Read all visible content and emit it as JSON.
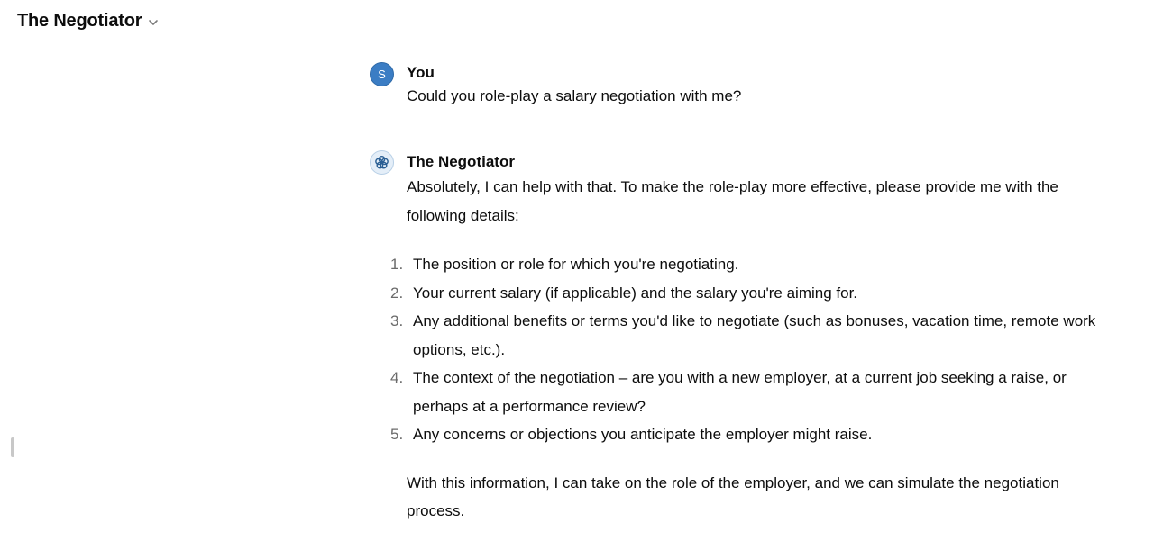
{
  "header": {
    "title": "The Negotiator",
    "chevron_icon": "chevron-down-icon"
  },
  "messages": {
    "user": {
      "avatar_letter": "S",
      "avatar_color": "#3b7dc4",
      "author": "You",
      "text": "Could you role-play a salary negotiation with me?"
    },
    "assistant": {
      "avatar_icon": "flower-logo-icon",
      "author": "The Negotiator",
      "intro": "Absolutely, I can help with that. To make the role-play more effective, please provide me with the following details:",
      "list": [
        {
          "num": "1.",
          "text": "The position or role for which you're negotiating."
        },
        {
          "num": "2.",
          "text": "Your current salary (if applicable) and the salary you're aiming for."
        },
        {
          "num": "3.",
          "text": "Any additional benefits or terms you'd like to negotiate (such as bonuses, vacation time, remote work options, etc.)."
        },
        {
          "num": "4.",
          "text": "The context of the negotiation – are you with a new employer, at a current job seeking a raise, or perhaps at a performance review?"
        },
        {
          "num": "5.",
          "text": "Any concerns or objections you anticipate the employer might raise."
        }
      ],
      "outro": "With this information, I can take on the role of the employer, and we can simulate the negotiation process."
    }
  }
}
